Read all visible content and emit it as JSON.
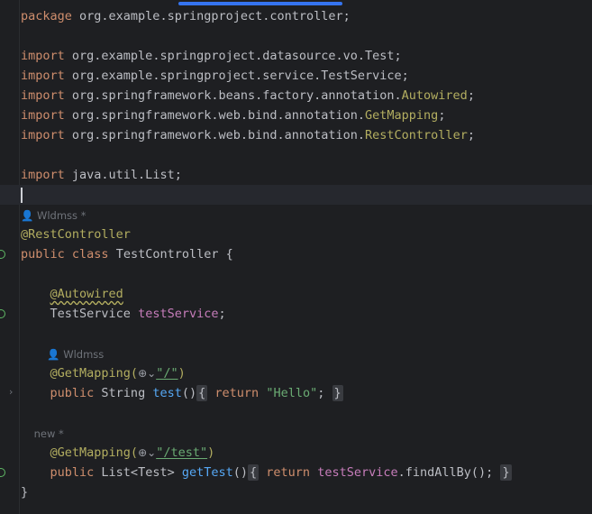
{
  "editor": {
    "lines": {
      "package": {
        "kw": "package",
        "rest": " org.example.springproject.controller;"
      },
      "import1": {
        "kw": "import",
        "rest": " org.example.springproject.datasource.vo.Test;"
      },
      "import2": {
        "kw": "import",
        "rest": " org.example.springproject.service.TestService;"
      },
      "import3": {
        "kw": "import",
        "pre": " org.springframework.beans.factory.annotation.",
        "ann": "Autowired",
        "post": ";"
      },
      "import4": {
        "kw": "import",
        "pre": " org.springframework.web.bind.annotation.",
        "ann": "GetMapping",
        "post": ";"
      },
      "import5": {
        "kw": "import",
        "pre": " org.springframework.web.bind.annotation.",
        "ann": "RestController",
        "post": ";"
      },
      "import6": {
        "kw": "import",
        "rest": " java.util.List;"
      },
      "author1": "Wldmss *",
      "class_ann": "@RestController",
      "class_decl": {
        "kw1": "public",
        "kw2": "class",
        "name": " TestController {"
      },
      "autowired": "@Autowired",
      "field": {
        "type": "TestService ",
        "name": "testService",
        "end": ";"
      },
      "author2": "Wldmss",
      "mapping1": {
        "ann": "@GetMapping(",
        "path": "\"/\"",
        "close": ")"
      },
      "method1": {
        "kw": "public",
        "type": " String ",
        "name": "test",
        "paren": "()",
        "open": "{",
        "ret": "return",
        "str": "\"Hello\"",
        "semi": ";",
        "close": "}"
      },
      "author3": "new *",
      "mapping2": {
        "ann": "@GetMapping(",
        "path": "\"/test\"",
        "close": ")"
      },
      "method2": {
        "kw": "public",
        "type": " List<Test> ",
        "name": "getTest",
        "paren": "()",
        "open": "{",
        "ret": "return",
        "fld": "testService",
        "call": ".findAllBy();",
        "close": "}"
      },
      "end": "}"
    },
    "globe_icon": "globe-icon",
    "globe_glyph": "⊕",
    "chevron_glyph": "⌄",
    "fold_glyph": "›"
  }
}
